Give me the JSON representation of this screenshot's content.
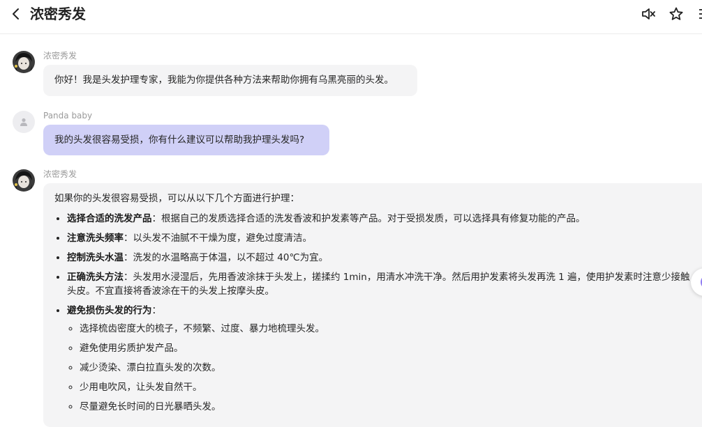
{
  "header": {
    "title": "浓密秀发",
    "back_icon": "chevron-left-icon",
    "mute_icon": "speaker-muted-icon",
    "star_icon": "star-icon",
    "menu_icon": "menu-icon"
  },
  "messages": [
    {
      "sender": "浓密秀发",
      "text": "你好！我是头发护理专家，我能为你提供各种方法来帮助你拥有乌黑亮丽的头发。"
    },
    {
      "sender": "Panda baby",
      "text": "我的头发很容易受损，你有什么建议可以帮助我护理头发吗?"
    },
    {
      "sender": "浓密秀发",
      "intro": "如果你的头发很容易受损，可以从以下几个方面进行护理：",
      "tips": [
        {
          "title": "选择合适的洗发产品",
          "text": "：根据自己的发质选择合适的洗发香波和护发素等产品。对于受损发质，可以选择具有修复功能的产品。"
        },
        {
          "title": "注意洗头频率",
          "text": "：以头发不油腻不干燥为度，避免过度清洁。"
        },
        {
          "title": "控制洗头水温",
          "text": "：洗发的水温略高于体温，以不超过 40℃为宜。"
        },
        {
          "title": "正确洗头方法",
          "text": "：头发用水浸湿后，先用香波涂抹于头发上，搓揉约 1min，用清水冲洗干净。然后用护发素将头发再洗 1 遍，使用护发素时注意少接触头皮。不宜直接将香波涂在干的头发上按摩头皮。"
        },
        {
          "title": "避免损伤头发的行为",
          "text": "："
        }
      ],
      "subtips": [
        "选择梳齿密度大的梳子，不频繁、过度、暴力地梳理头发。",
        "避免使用劣质护发产品。",
        "减少烫染、漂白拉直头发的次数。",
        "少用电吹风，让头发自然干。",
        "尽量避免长时间的日光暴晒头发。"
      ]
    }
  ],
  "colors": {
    "user_bubble": "#d0d0f7",
    "bot_bubble": "#f4f4f5",
    "sender_text": "#9a9a9a",
    "accent": "#8f7cf2"
  }
}
